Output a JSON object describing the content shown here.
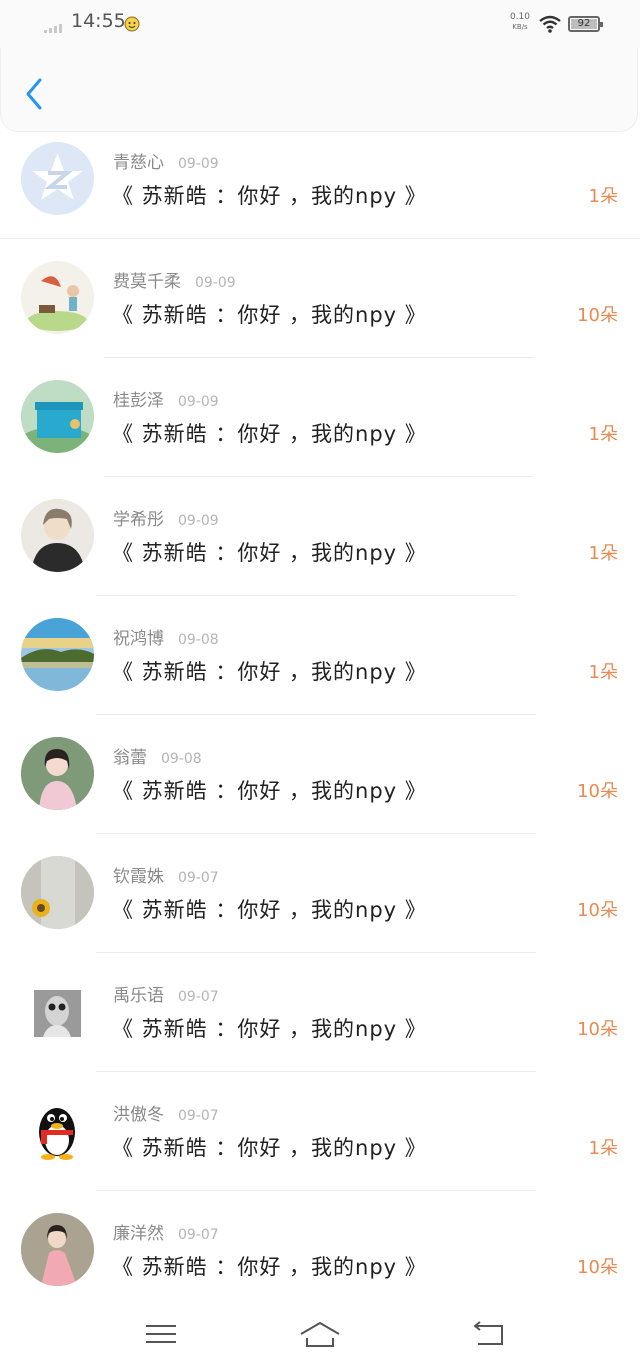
{
  "status_bar": {
    "time": "14:55",
    "net_speed_value": "0.10",
    "net_speed_unit": "KB/s",
    "battery": "92"
  },
  "header": {
    "back_icon": "chevron-left-icon",
    "accent_color": "#2196f3"
  },
  "entries": [
    {
      "name": "青慈心",
      "date": "09-09",
      "message": "《 苏新皓 ：你好 ，我的npy 》",
      "gift": "1朵",
      "avatar": "qzone-star-icon"
    },
    {
      "name": "费莫千柔",
      "date": "09-09",
      "message": "《 苏新皓 ：你好 ，我的npy 》",
      "gift": "10朵",
      "avatar": "girl-gramophone-illustration"
    },
    {
      "name": "桂彭泽",
      "date": "09-09",
      "message": "《 苏新皓 ：你好 ，我的npy 》",
      "gift": "1朵",
      "avatar": "blue-gift-box-photo"
    },
    {
      "name": "学希彤",
      "date": "09-09",
      "message": "《 苏新皓 ：你好 ，我的npy 》",
      "gift": "1朵",
      "avatar": "anime-boy-jacket"
    },
    {
      "name": "祝鸿博",
      "date": "09-08",
      "message": "《 苏新皓 ：你好 ，我的npy 》",
      "gift": "1朵",
      "avatar": "lake-landscape-photo"
    },
    {
      "name": "翁蕾",
      "date": "09-08",
      "message": "《 苏新皓 ：你好 ，我的npy 》",
      "gift": "10朵",
      "avatar": "girl-portrait-photo"
    },
    {
      "name": "钦霞姝",
      "date": "09-07",
      "message": "《 苏新皓 ：你好 ，我的npy 》",
      "gift": "10朵",
      "avatar": "sunflower-shirt-photo"
    },
    {
      "name": "禹乐语",
      "date": "09-07",
      "message": "《 苏新皓 ：你好 ，我的npy 》",
      "gift": "10朵",
      "avatar": "bw-sunglasses-portrait"
    },
    {
      "name": "洪傲冬",
      "date": "09-07",
      "message": "《 苏新皓 ：你好 ，我的npy 》",
      "gift": "1朵",
      "avatar": "qq-penguin-icon"
    },
    {
      "name": "廉洋然",
      "date": "09-07",
      "message": "《 苏新皓 ：你好 ，我的npy 》",
      "gift": "10朵",
      "avatar": "girl-pink-hanfu-photo"
    }
  ],
  "navbar": {
    "menu_icon": "menu-icon",
    "home_icon": "home-icon",
    "back_icon": "back-icon"
  }
}
